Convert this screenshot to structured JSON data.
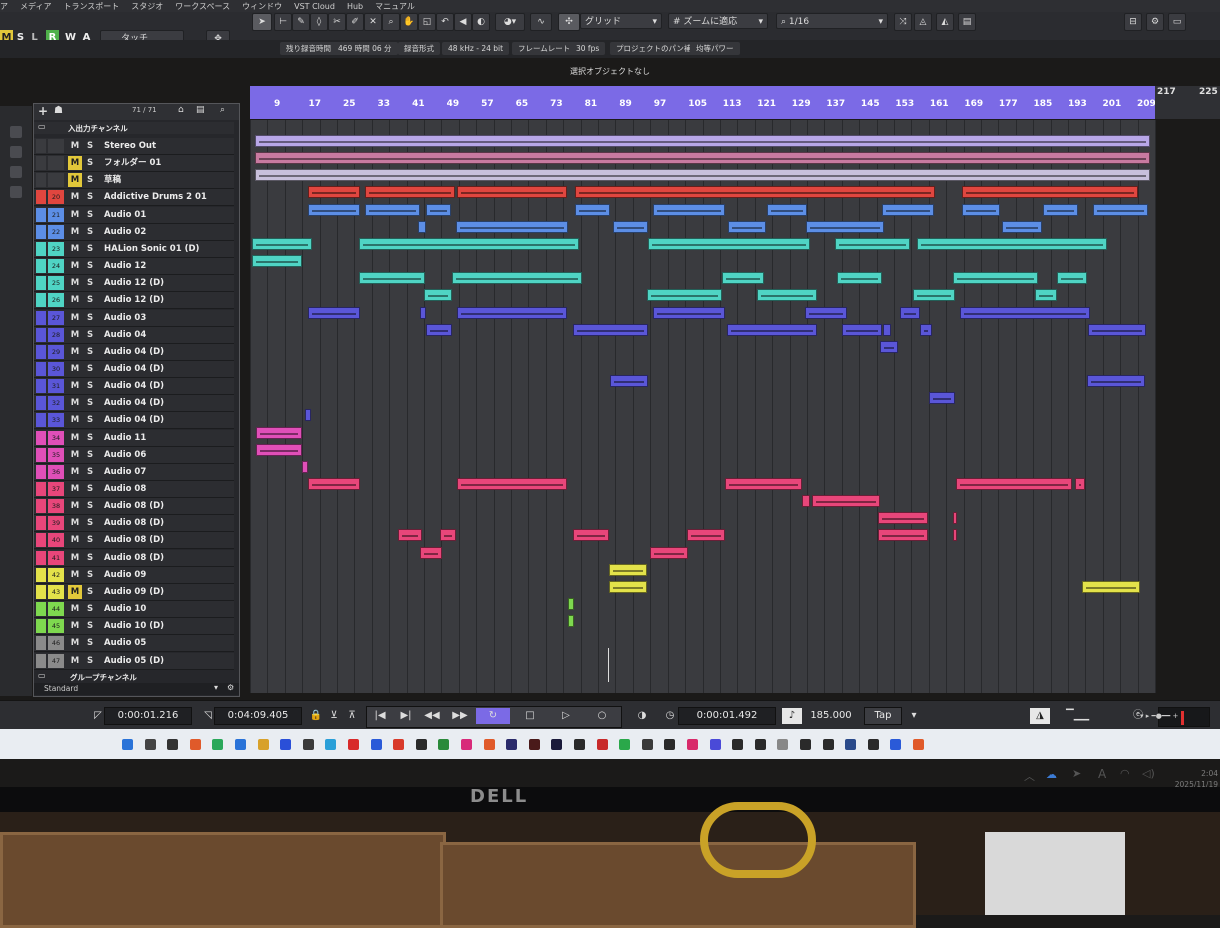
{
  "menu": [
    "ア",
    "メディア",
    "トランスポート",
    "スタジオ",
    "ワークスペース",
    "ウィンドウ",
    "VST Cloud",
    "Hub",
    "マニュアル"
  ],
  "toolbar": {
    "msl": [
      "M",
      "S",
      "L",
      "R",
      "W",
      "A"
    ],
    "automation_mode": "タッチ",
    "snap_type": "グリッド",
    "zoom_mode": "ズームに適応",
    "quantize": "1/16"
  },
  "infoline": {
    "remaining_label": "残り録音時間",
    "remaining_value": "469 時間 06 分",
    "format_label": "録音形式",
    "format_value": "48 kHz - 24 bit",
    "framerate_label": "フレームレート",
    "framerate_value": "30 fps",
    "pan_label": "プロジェクトのパン補正",
    "pan_value": "均等パワー"
  },
  "selection_title": "選択オブジェクトなし",
  "tracklist": {
    "counter": "71 / 71",
    "top_folder": "入出力チャンネル",
    "bottom_folder": "グループチャンネル",
    "footer": "Standard"
  },
  "tracks": [
    {
      "num": "",
      "name": "Stereo Out",
      "color": "#3a3b3f",
      "m_on": false
    },
    {
      "num": "",
      "name": "フォルダー 01",
      "color": "#3a3b3f",
      "m_on": true
    },
    {
      "num": "",
      "name": "草稿",
      "color": "#3a3b3f",
      "m_on": true
    },
    {
      "num": "20",
      "name": "Addictive Drums 2 01",
      "color": "#e0463f",
      "m_on": false
    },
    {
      "num": "21",
      "name": "Audio 01",
      "color": "#5c8ee6",
      "m_on": false
    },
    {
      "num": "22",
      "name": "Audio 02",
      "color": "#5c8ee6",
      "m_on": false
    },
    {
      "num": "23",
      "name": "HALion Sonic 01 (D)",
      "color": "#4fd4c4",
      "m_on": false
    },
    {
      "num": "24",
      "name": "Audio 12",
      "color": "#4fd4c4",
      "m_on": false
    },
    {
      "num": "25",
      "name": "Audio 12 (D)",
      "color": "#4fd4c4",
      "m_on": false
    },
    {
      "num": "26",
      "name": "Audio 12 (D)",
      "color": "#4fd4c4",
      "m_on": false
    },
    {
      "num": "27",
      "name": "Audio 03",
      "color": "#5a56d8",
      "m_on": false
    },
    {
      "num": "28",
      "name": "Audio 04",
      "color": "#5a56d8",
      "m_on": false
    },
    {
      "num": "29",
      "name": "Audio 04 (D)",
      "color": "#5a56d8",
      "m_on": false
    },
    {
      "num": "30",
      "name": "Audio 04 (D)",
      "color": "#5a56d8",
      "m_on": false
    },
    {
      "num": "31",
      "name": "Audio 04 (D)",
      "color": "#5a56d8",
      "m_on": false
    },
    {
      "num": "32",
      "name": "Audio 04 (D)",
      "color": "#5a56d8",
      "m_on": false
    },
    {
      "num": "33",
      "name": "Audio 04 (D)",
      "color": "#5a56d8",
      "m_on": false
    },
    {
      "num": "34",
      "name": "Audio 11",
      "color": "#e04fb8",
      "m_on": false
    },
    {
      "num": "35",
      "name": "Audio 06",
      "color": "#e04fb8",
      "m_on": false
    },
    {
      "num": "36",
      "name": "Audio 07",
      "color": "#e04fb8",
      "m_on": false
    },
    {
      "num": "37",
      "name": "Audio 08",
      "color": "#e8467a",
      "m_on": false
    },
    {
      "num": "38",
      "name": "Audio 08 (D)",
      "color": "#e8467a",
      "m_on": false
    },
    {
      "num": "39",
      "name": "Audio 08 (D)",
      "color": "#e8467a",
      "m_on": false
    },
    {
      "num": "40",
      "name": "Audio 08 (D)",
      "color": "#e8467a",
      "m_on": false
    },
    {
      "num": "41",
      "name": "Audio 08 (D)",
      "color": "#e8467a",
      "m_on": false
    },
    {
      "num": "42",
      "name": "Audio 09",
      "color": "#e3e24a",
      "m_on": false
    },
    {
      "num": "43",
      "name": "Audio 09 (D)",
      "color": "#e3e24a",
      "m_on": true
    },
    {
      "num": "44",
      "name": "Audio 10",
      "color": "#7ed84f",
      "m_on": false
    },
    {
      "num": "45",
      "name": "Audio 10 (D)",
      "color": "#7ed84f",
      "m_on": false
    },
    {
      "num": "46",
      "name": "Audio 05",
      "color": "#8a8a8a",
      "m_on": false
    },
    {
      "num": "47",
      "name": "Audio 05 (D)",
      "color": "#8a8a8a",
      "m_on": false
    }
  ],
  "ruler": [
    "9",
    "17",
    "25",
    "33",
    "41",
    "49",
    "57",
    "65",
    "73",
    "81",
    "89",
    "97",
    "105",
    "113",
    "121",
    "129",
    "137",
    "145",
    "153",
    "161",
    "169",
    "177",
    "185",
    "193",
    "201",
    "209"
  ],
  "ruler_extra": [
    "217",
    "225"
  ],
  "transport": {
    "left_locator": "0:00:01.216",
    "right_locator": "0:04:09.405",
    "position": "0:00:01.492",
    "tempo": "185.000",
    "tap": "Tap"
  },
  "taskbar": {
    "time": "2:04",
    "date": "2025/11/19"
  },
  "monitor_brand": "DELL"
}
